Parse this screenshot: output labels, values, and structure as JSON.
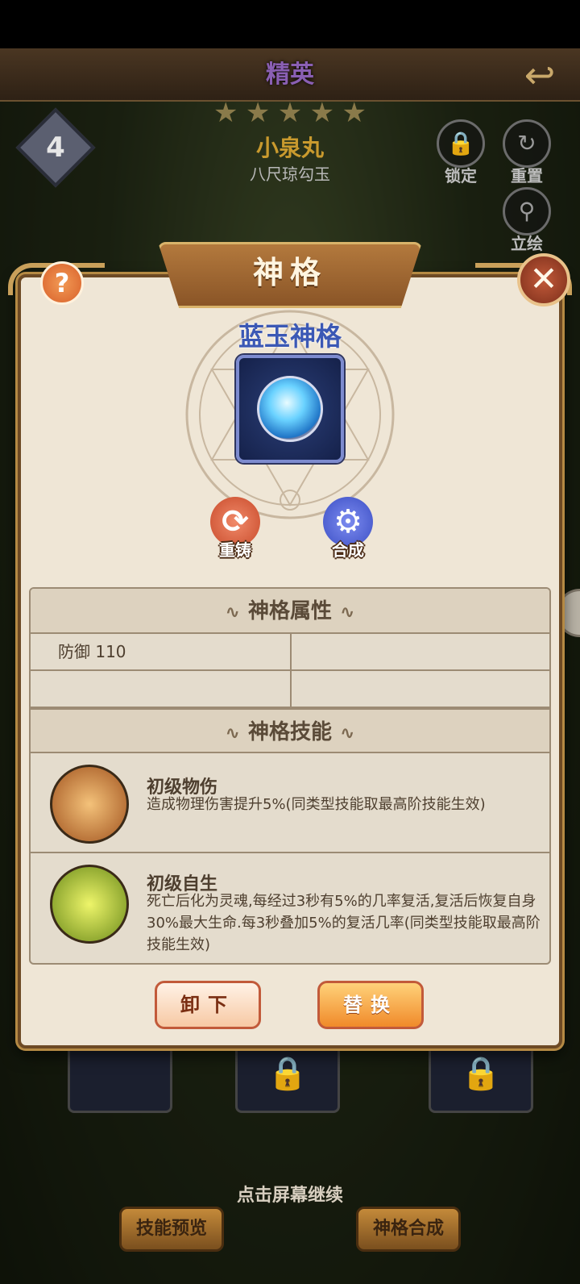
{
  "hero": {
    "rank": "精英",
    "stars": [
      "★",
      "★",
      "★",
      "★",
      "★"
    ],
    "level": "4",
    "name": "小泉丸",
    "subtitle": "八尺琼勾玉"
  },
  "top_actions": {
    "lock": "锁定",
    "reset": "重置",
    "artwork": "立绘"
  },
  "dialog": {
    "title": "神格",
    "gem_name": "蓝玉神格",
    "actions": {
      "reforge": "重铸",
      "synthesize": "合成"
    },
    "attributes_header": "神格属性",
    "attributes": [
      [
        "防御  110",
        ""
      ],
      [
        "",
        ""
      ]
    ],
    "skills_header": "神格技能",
    "skills": [
      {
        "name": "初级物伤",
        "desc": "造成物理伤害提升5%(同类型技能取最高阶技能生效)",
        "icon": "fist-icon"
      },
      {
        "name": "初级自生",
        "desc": "死亡后化为灵魂,每经过3秒有5%的几率复活,复活后恢复自身30%最大生命.每3秒叠加5%的复活几率(同类型技能取最高阶技能生效)",
        "icon": "spirit-icon"
      }
    ],
    "unequip_label": "卸下",
    "replace_label": "替换"
  },
  "bottom": {
    "skill_preview": "技能预览",
    "synth": "神格合成",
    "continue_hint": "点击屏幕继续"
  },
  "colors": {
    "gem_name": "#3b58b5",
    "accent_orange": "#f08a2a",
    "panel_bg": "#efe6d6"
  }
}
